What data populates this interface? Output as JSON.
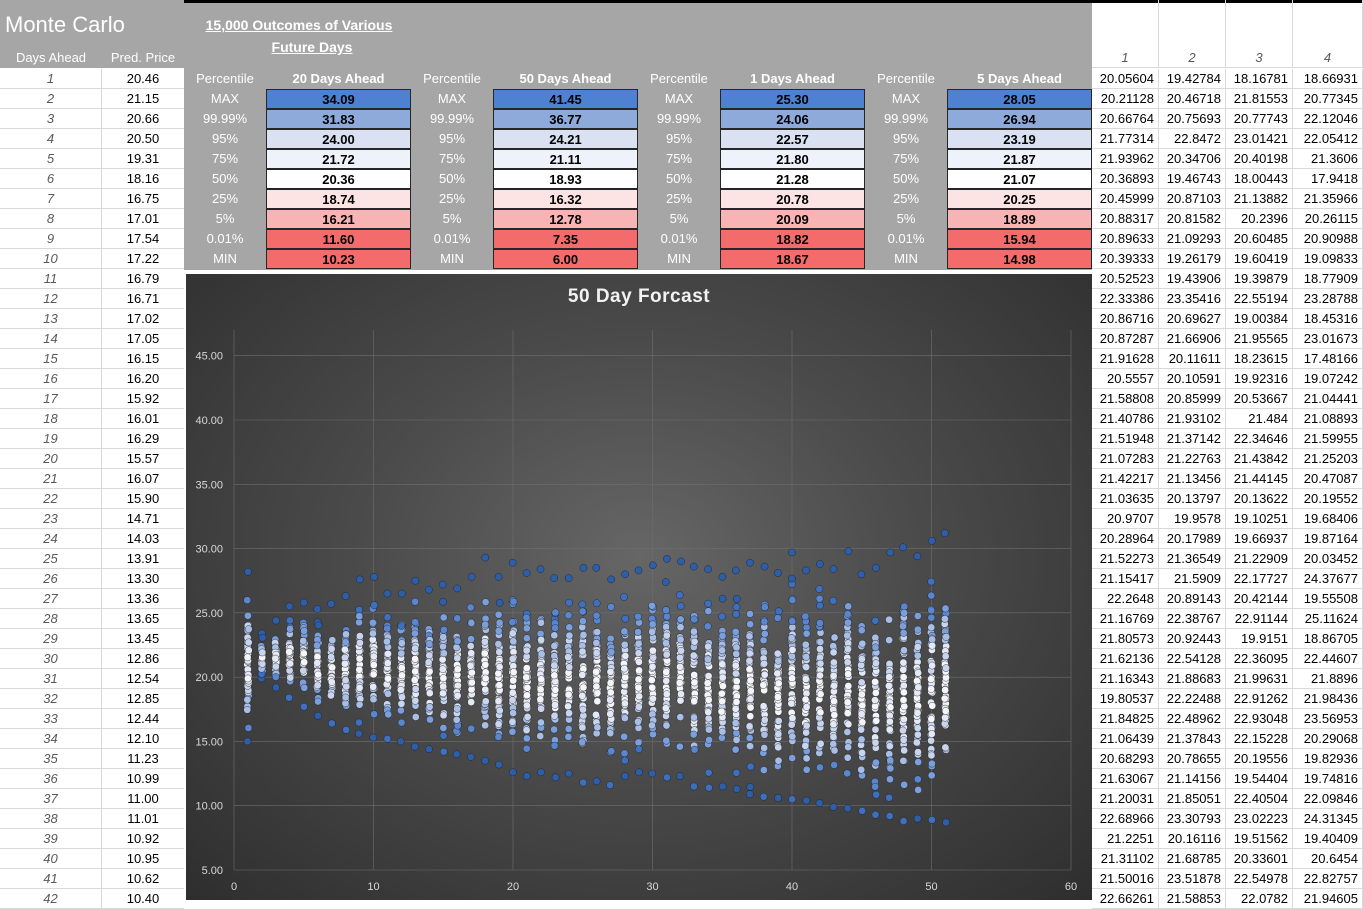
{
  "title": "Monte Carlo",
  "left_headers": {
    "days": "Days Ahead",
    "price": "Pred. Price"
  },
  "left_rows": [
    [
      "1",
      "20.46"
    ],
    [
      "2",
      "21.15"
    ],
    [
      "3",
      "20.66"
    ],
    [
      "4",
      "20.50"
    ],
    [
      "5",
      "19.31"
    ],
    [
      "6",
      "18.16"
    ],
    [
      "7",
      "16.75"
    ],
    [
      "8",
      "17.01"
    ],
    [
      "9",
      "17.54"
    ],
    [
      "10",
      "17.22"
    ],
    [
      "11",
      "16.79"
    ],
    [
      "12",
      "16.71"
    ],
    [
      "13",
      "17.02"
    ],
    [
      "14",
      "17.05"
    ],
    [
      "15",
      "16.15"
    ],
    [
      "16",
      "16.20"
    ],
    [
      "17",
      "15.92"
    ],
    [
      "18",
      "16.01"
    ],
    [
      "19",
      "16.29"
    ],
    [
      "20",
      "15.57"
    ],
    [
      "21",
      "16.07"
    ],
    [
      "22",
      "15.90"
    ],
    [
      "23",
      "14.71"
    ],
    [
      "24",
      "14.03"
    ],
    [
      "25",
      "13.91"
    ],
    [
      "26",
      "13.30"
    ],
    [
      "27",
      "13.36"
    ],
    [
      "28",
      "13.65"
    ],
    [
      "29",
      "13.45"
    ],
    [
      "30",
      "12.86"
    ],
    [
      "31",
      "12.54"
    ],
    [
      "32",
      "12.85"
    ],
    [
      "33",
      "12.44"
    ],
    [
      "34",
      "12.10"
    ],
    [
      "35",
      "11.23"
    ],
    [
      "36",
      "10.99"
    ],
    [
      "37",
      "11.00"
    ],
    [
      "38",
      "11.01"
    ],
    [
      "39",
      "10.92"
    ],
    [
      "40",
      "10.95"
    ],
    [
      "41",
      "10.62"
    ],
    [
      "42",
      "10.40"
    ]
  ],
  "outcomes_title_line1": "15,000 Outcomes of Various",
  "outcomes_title_line2": "Future Days",
  "percentile_label": "Percentile",
  "percentile_rows": [
    "MAX",
    "99.99%",
    "95%",
    "75%",
    "50%",
    "25%",
    "5%",
    "0.01%",
    "MIN"
  ],
  "tables": [
    {
      "heading": "20 Days Ahead",
      "values": [
        "34.09",
        "31.83",
        "24.00",
        "21.72",
        "20.36",
        "18.74",
        "16.21",
        "11.60",
        "10.23"
      ]
    },
    {
      "heading": "50 Days Ahead",
      "values": [
        "41.45",
        "36.77",
        "24.21",
        "21.11",
        "18.93",
        "16.32",
        "12.78",
        "7.35",
        "6.00"
      ]
    },
    {
      "heading": "1 Days Ahead",
      "values": [
        "25.30",
        "24.06",
        "22.57",
        "21.80",
        "21.28",
        "20.78",
        "20.09",
        "18.82",
        "18.67"
      ]
    },
    {
      "heading": "5 Days Ahead",
      "values": [
        "28.05",
        "26.94",
        "23.19",
        "21.87",
        "21.07",
        "20.25",
        "18.89",
        "15.94",
        "14.98"
      ]
    }
  ],
  "cell_colors": [
    "#4f81d2",
    "#8eaadb",
    "#d9e1f2",
    "#eef2fa",
    "#ffffff",
    "#fce4e4",
    "#f8b4b4",
    "#f36b6b",
    "#f36b6b"
  ],
  "right_headers": [
    "1",
    "2",
    "3",
    "4"
  ],
  "right_rows": [
    [
      "20.05604",
      "19.42784",
      "18.16781",
      "18.66931"
    ],
    [
      "20.21128",
      "20.46718",
      "21.81553",
      "20.77345"
    ],
    [
      "20.66764",
      "20.75693",
      "20.77743",
      "22.12046"
    ],
    [
      "21.77314",
      "22.8472",
      "23.01421",
      "22.05412"
    ],
    [
      "21.93962",
      "20.34706",
      "20.40198",
      "21.3606"
    ],
    [
      "20.36893",
      "19.46743",
      "18.00443",
      "17.9418"
    ],
    [
      "20.45999",
      "20.87103",
      "21.13882",
      "21.35966"
    ],
    [
      "20.88317",
      "20.81582",
      "20.2396",
      "20.26115"
    ],
    [
      "20.89633",
      "21.09293",
      "20.60485",
      "20.90988"
    ],
    [
      "20.39333",
      "19.26179",
      "19.60419",
      "19.09833"
    ],
    [
      "20.52523",
      "19.43906",
      "19.39879",
      "18.77909"
    ],
    [
      "22.33386",
      "23.35416",
      "22.55194",
      "23.28788"
    ],
    [
      "20.86716",
      "20.69627",
      "19.00384",
      "18.45316"
    ],
    [
      "20.87287",
      "21.66906",
      "21.95565",
      "23.01673"
    ],
    [
      "21.91628",
      "20.11611",
      "18.23615",
      "17.48166"
    ],
    [
      "20.5557",
      "20.10591",
      "19.92316",
      "19.07242"
    ],
    [
      "21.58808",
      "20.85999",
      "20.53667",
      "21.04441"
    ],
    [
      "21.40786",
      "21.93102",
      "21.484",
      "21.08893"
    ],
    [
      "21.51948",
      "21.37142",
      "22.34646",
      "21.59955"
    ],
    [
      "21.07283",
      "21.22763",
      "21.43842",
      "21.25203"
    ],
    [
      "21.42217",
      "21.13456",
      "21.44145",
      "20.47087"
    ],
    [
      "21.03635",
      "20.13797",
      "20.13622",
      "20.19552"
    ],
    [
      "20.9707",
      "19.9578",
      "19.10251",
      "19.68406"
    ],
    [
      "20.28964",
      "20.17989",
      "19.66937",
      "19.87164"
    ],
    [
      "21.52273",
      "21.36549",
      "21.22909",
      "20.03452"
    ],
    [
      "21.15417",
      "21.5909",
      "22.17727",
      "24.37677"
    ],
    [
      "22.2648",
      "20.89143",
      "20.42144",
      "19.55508"
    ],
    [
      "21.16769",
      "22.38767",
      "22.91144",
      "25.11624"
    ],
    [
      "21.80573",
      "20.92443",
      "19.9151",
      "18.86705"
    ],
    [
      "21.62136",
      "22.54128",
      "22.36095",
      "22.44607"
    ],
    [
      "21.16343",
      "21.88683",
      "21.99631",
      "21.8896"
    ],
    [
      "19.80537",
      "22.22488",
      "22.91262",
      "21.98436"
    ],
    [
      "21.84825",
      "22.48962",
      "22.93048",
      "23.56953"
    ],
    [
      "21.06439",
      "21.37843",
      "22.15228",
      "20.29068"
    ],
    [
      "20.68293",
      "20.78655",
      "20.19556",
      "19.82936"
    ],
    [
      "21.63067",
      "21.14156",
      "19.54404",
      "19.74816"
    ],
    [
      "21.20031",
      "21.85051",
      "22.40504",
      "22.09846"
    ],
    [
      "22.68966",
      "23.30793",
      "23.02223",
      "24.31345"
    ],
    [
      "21.2251",
      "20.16116",
      "19.51562",
      "19.40409"
    ],
    [
      "21.31102",
      "21.68785",
      "20.33601",
      "20.6454"
    ],
    [
      "21.50016",
      "23.51878",
      "22.54978",
      "22.82757"
    ],
    [
      "22.66261",
      "21.58853",
      "22.0782",
      "21.94605"
    ]
  ],
  "chart_data": {
    "type": "scatter",
    "title": "50 Day Forcast",
    "xlim": [
      0,
      60
    ],
    "ylim": [
      5,
      47
    ],
    "x_ticks": [
      "0",
      "10",
      "20",
      "30",
      "40",
      "50",
      "60"
    ],
    "y_ticks": [
      "5.00",
      "10.00",
      "15.00",
      "20.00",
      "25.00",
      "30.00",
      "35.00",
      "40.00",
      "45.00"
    ],
    "x_tick_values": [
      0,
      10,
      20,
      30,
      40,
      50,
      60
    ],
    "y_tick_values": [
      5,
      10,
      15,
      20,
      25,
      30,
      35,
      40,
      45
    ],
    "grid": true,
    "legend": "none",
    "columns": [
      {
        "x": 1,
        "min": 15.0,
        "max": 28.2
      },
      {
        "x": 2,
        "min": 19.9,
        "max": 23.4
      },
      {
        "x": 3,
        "min": 19.2,
        "max": 24.4
      },
      {
        "x": 4,
        "min": 18.4,
        "max": 25.5
      },
      {
        "x": 5,
        "min": 17.7,
        "max": 25.8
      },
      {
        "x": 6,
        "min": 17.0,
        "max": 25.3
      },
      {
        "x": 7,
        "min": 16.4,
        "max": 25.7
      },
      {
        "x": 8,
        "min": 15.9,
        "max": 26.3
      },
      {
        "x": 9,
        "min": 15.6,
        "max": 27.6
      },
      {
        "x": 10,
        "min": 15.3,
        "max": 27.8
      },
      {
        "x": 11,
        "min": 15.2,
        "max": 26.5
      },
      {
        "x": 12,
        "min": 15.0,
        "max": 26.5
      },
      {
        "x": 13,
        "min": 14.6,
        "max": 27.5
      },
      {
        "x": 14,
        "min": 14.4,
        "max": 26.8
      },
      {
        "x": 15,
        "min": 14.2,
        "max": 27.2
      },
      {
        "x": 16,
        "min": 14.0,
        "max": 26.9
      },
      {
        "x": 17,
        "min": 13.8,
        "max": 27.8
      },
      {
        "x": 18,
        "min": 13.5,
        "max": 29.3
      },
      {
        "x": 19,
        "min": 13.2,
        "max": 27.8
      },
      {
        "x": 20,
        "min": 12.6,
        "max": 28.9
      },
      {
        "x": 21,
        "min": 12.3,
        "max": 28.1
      },
      {
        "x": 22,
        "min": 12.6,
        "max": 28.4
      },
      {
        "x": 23,
        "min": 12.2,
        "max": 27.7
      },
      {
        "x": 24,
        "min": 12.5,
        "max": 27.7
      },
      {
        "x": 25,
        "min": 11.8,
        "max": 28.5
      },
      {
        "x": 26,
        "min": 11.9,
        "max": 28.5
      },
      {
        "x": 27,
        "min": 11.6,
        "max": 27.6
      },
      {
        "x": 28,
        "min": 12.3,
        "max": 28.0
      },
      {
        "x": 29,
        "min": 12.6,
        "max": 28.3
      },
      {
        "x": 30,
        "min": 12.5,
        "max": 28.7
      },
      {
        "x": 31,
        "min": 12.2,
        "max": 29.2
      },
      {
        "x": 32,
        "min": 12.3,
        "max": 29.0
      },
      {
        "x": 33,
        "min": 11.5,
        "max": 28.6
      },
      {
        "x": 34,
        "min": 11.4,
        "max": 28.4
      },
      {
        "x": 35,
        "min": 11.5,
        "max": 27.8
      },
      {
        "x": 36,
        "min": 11.3,
        "max": 28.3
      },
      {
        "x": 37,
        "min": 10.9,
        "max": 28.9
      },
      {
        "x": 38,
        "min": 10.7,
        "max": 28.6
      },
      {
        "x": 39,
        "min": 10.6,
        "max": 28.1
      },
      {
        "x": 40,
        "min": 10.5,
        "max": 29.7
      },
      {
        "x": 41,
        "min": 10.4,
        "max": 28.3
      },
      {
        "x": 42,
        "min": 10.2,
        "max": 28.8
      },
      {
        "x": 43,
        "min": 9.9,
        "max": 28.4
      },
      {
        "x": 44,
        "min": 9.8,
        "max": 29.8
      },
      {
        "x": 45,
        "min": 9.6,
        "max": 28.0
      },
      {
        "x": 46,
        "min": 9.3,
        "max": 28.5
      },
      {
        "x": 47,
        "min": 9.2,
        "max": 29.7
      },
      {
        "x": 48,
        "min": 8.8,
        "max": 30.1
      },
      {
        "x": 49,
        "min": 9.0,
        "max": 29.4
      },
      {
        "x": 50,
        "min": 8.9,
        "max": 30.6
      },
      {
        "x": 51,
        "min": 8.7,
        "max": 31.2
      }
    ]
  }
}
